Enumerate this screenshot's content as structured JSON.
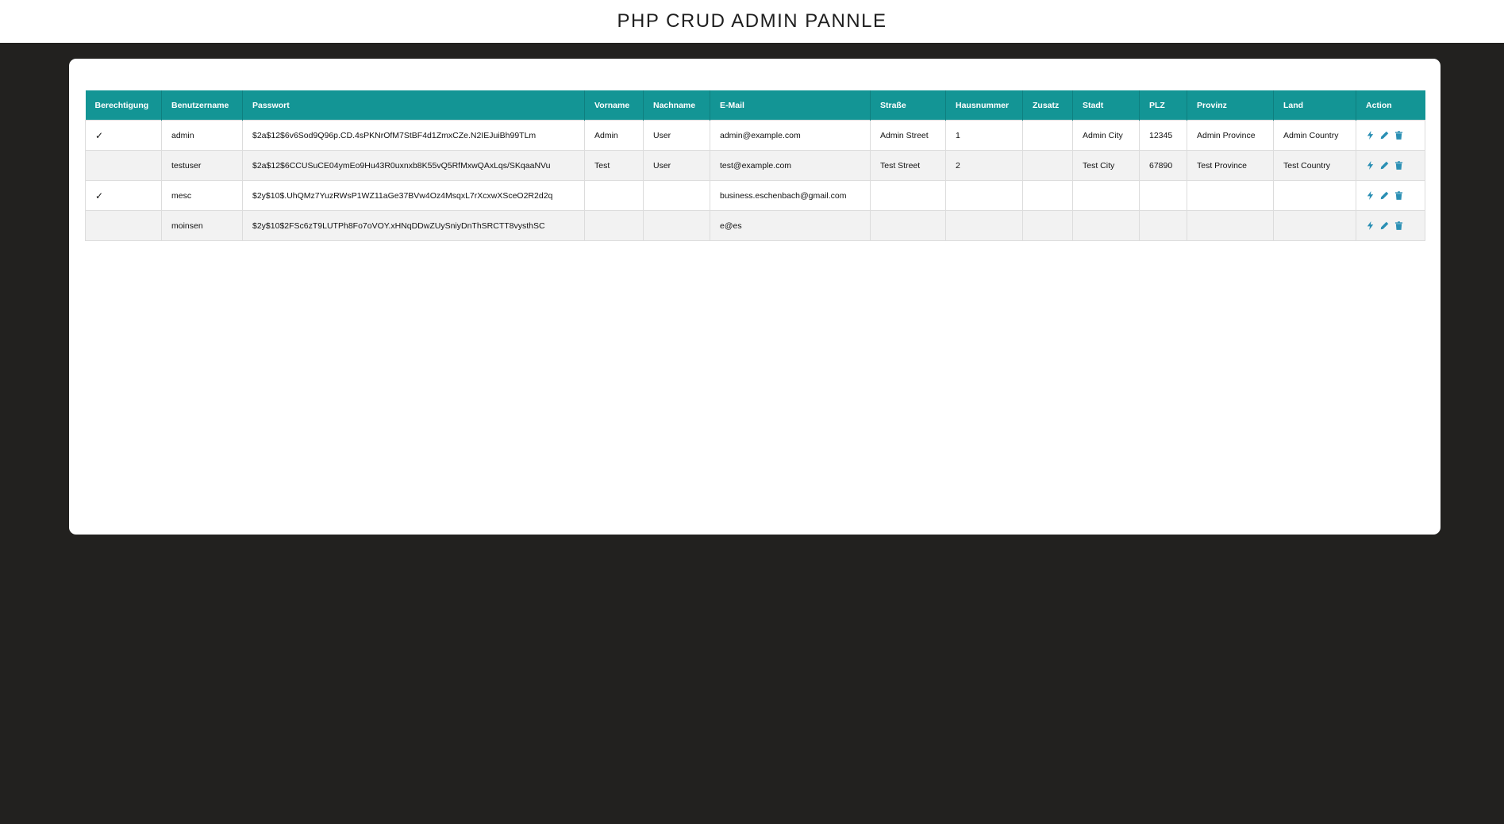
{
  "header": {
    "title": "PHP CRUD ADMIN PANNLE"
  },
  "table": {
    "columns": [
      "Berechtigung",
      "Benutzername",
      "Passwort",
      "Vorname",
      "Nachname",
      "E-Mail",
      "Straße",
      "Hausnummer",
      "Zusatz",
      "Stadt",
      "PLZ",
      "Provinz",
      "Land",
      "Action"
    ],
    "rows": [
      {
        "berechtigung": "✓",
        "benutzername": "admin",
        "passwort": "$2a$12$6v6Sod9Q96p.CD.4sPKNrOfM7StBF4d1ZmxCZe.N2IEJuiBh99TLm",
        "vorname": "Admin",
        "nachname": "User",
        "email": "admin@example.com",
        "strasse": "Admin Street",
        "hausnummer": "1",
        "zusatz": "",
        "stadt": "Admin City",
        "plz": "12345",
        "provinz": "Admin Province",
        "land": "Admin Country"
      },
      {
        "berechtigung": "",
        "benutzername": "testuser",
        "passwort": "$2a$12$6CCUSuCE04ymEo9Hu43R0uxnxb8K55vQ5RfMxwQAxLqs/SKqaaNVu",
        "vorname": "Test",
        "nachname": "User",
        "email": "test@example.com",
        "strasse": "Test Street",
        "hausnummer": "2",
        "zusatz": "",
        "stadt": "Test City",
        "plz": "67890",
        "provinz": "Test Province",
        "land": "Test Country"
      },
      {
        "berechtigung": "✓",
        "benutzername": "mesc",
        "passwort": "$2y$10$.UhQMz7YuzRWsP1WZ11aGe37BVw4Oz4MsqxL7rXcxwXSceO2R2d2q",
        "vorname": "",
        "nachname": "",
        "email": "business.eschenbach@gmail.com",
        "strasse": "",
        "hausnummer": "",
        "zusatz": "",
        "stadt": "",
        "plz": "",
        "provinz": "",
        "land": ""
      },
      {
        "berechtigung": "",
        "benutzername": "moinsen",
        "passwort": "$2y$10$2FSc6zT9LUTPh8Fo7oVOY.xHNqDDwZUySniyDnThSRCTT8vysthSC",
        "vorname": "",
        "nachname": "",
        "email": "e@es",
        "strasse": "",
        "hausnummer": "",
        "zusatz": "",
        "stadt": "",
        "plz": "",
        "provinz": "",
        "land": ""
      }
    ],
    "action_icons": [
      "bolt-icon",
      "pencil-icon",
      "trash-icon"
    ]
  },
  "colors": {
    "header_bg": "#139595",
    "page_bg": "#22211f",
    "icon": "#2a8fb4"
  }
}
